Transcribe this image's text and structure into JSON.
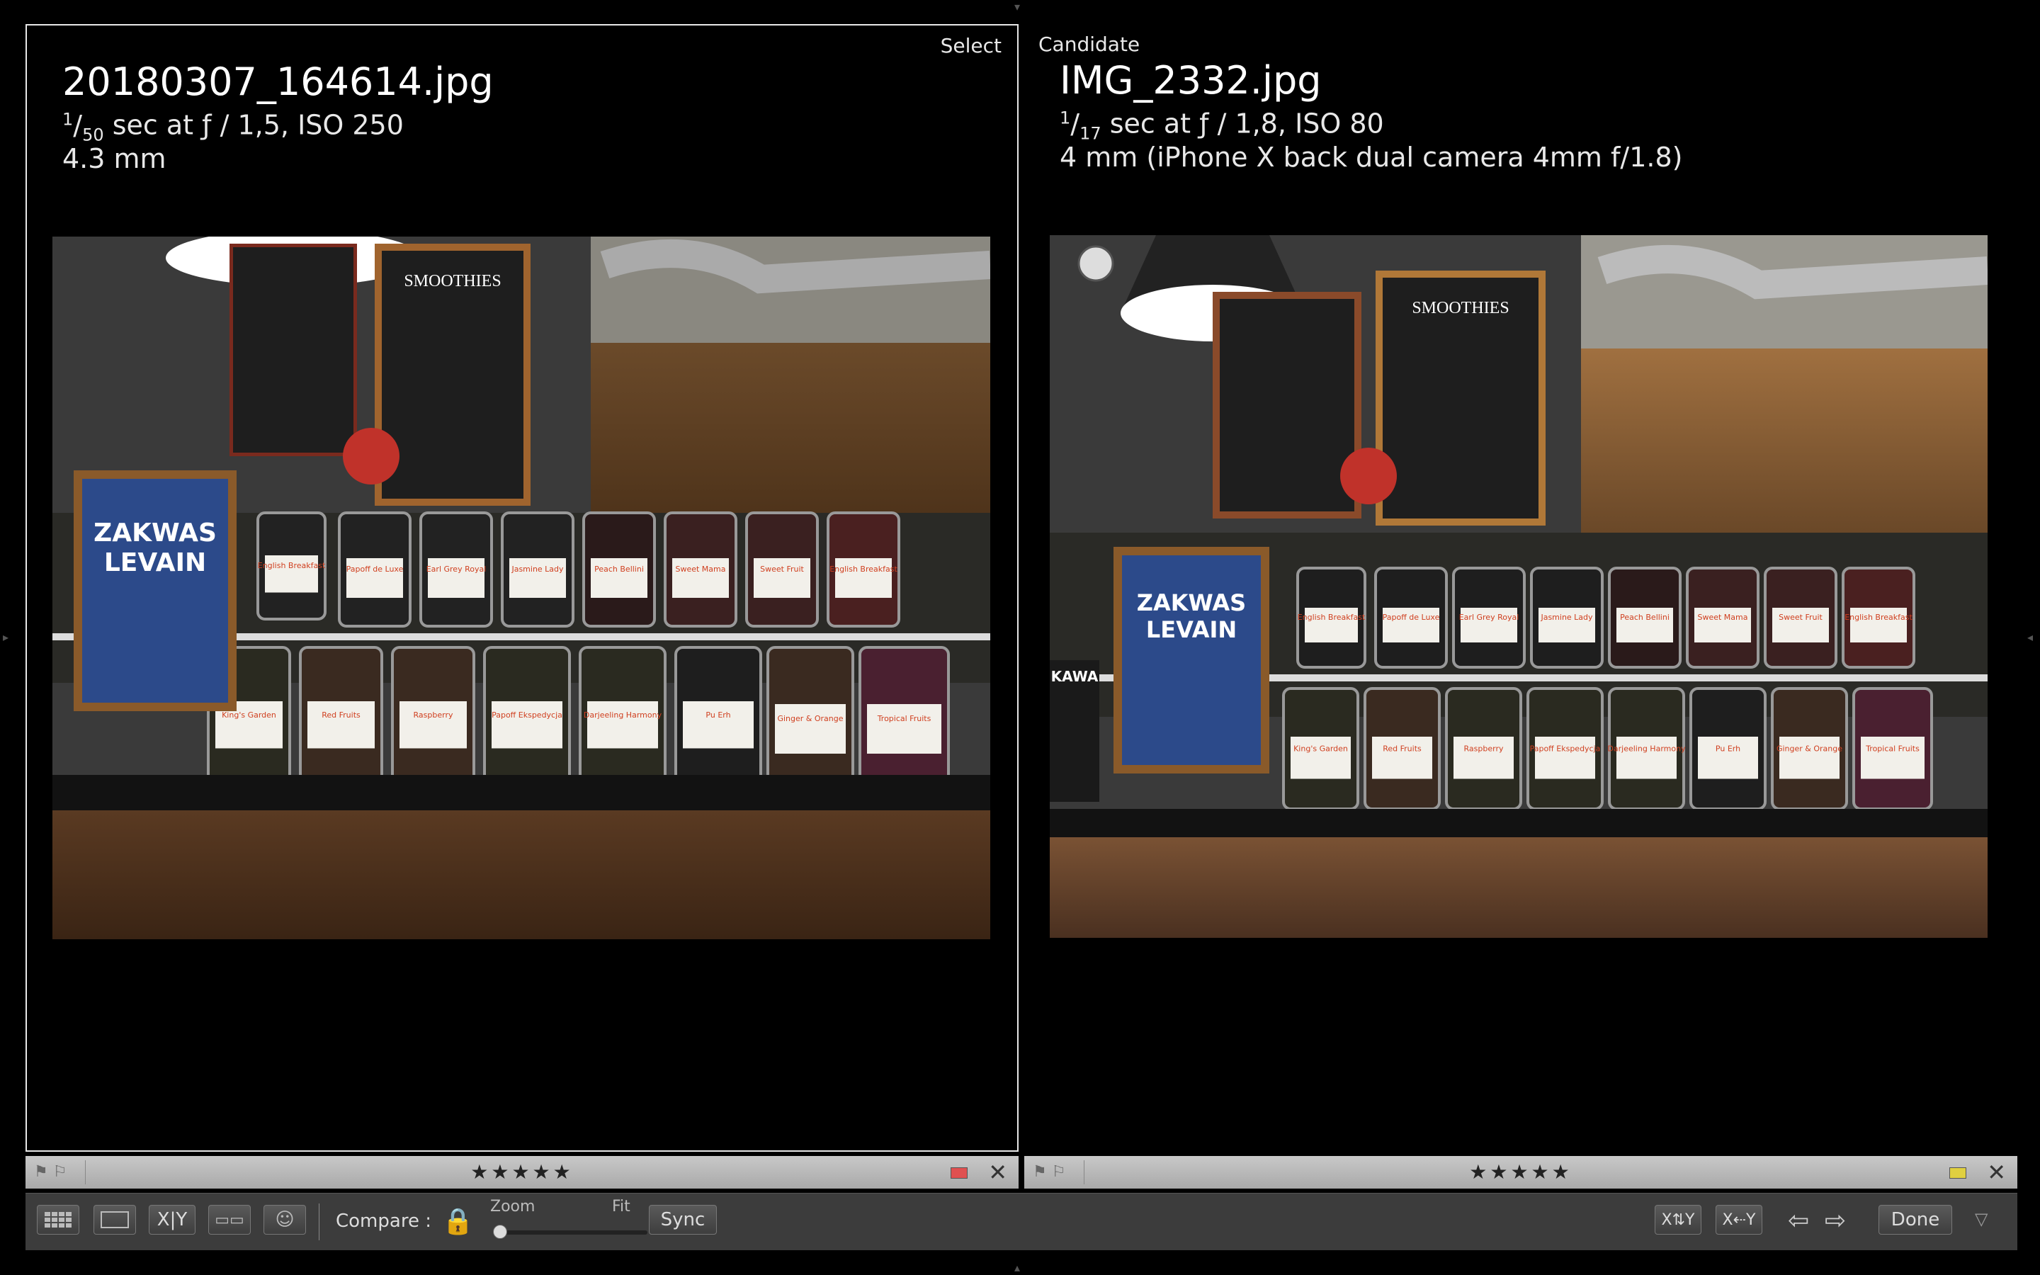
{
  "left": {
    "role": "Select",
    "filename": "20180307_164614.jpg",
    "exposure_num": "1",
    "exposure_den": "50",
    "exposure_rest": " sec at ƒ / 1,5, ISO 250",
    "focal": "4.3 mm",
    "stars": "★★★★★",
    "color_label": "#e05050"
  },
  "right": {
    "role": "Candidate",
    "filename": "IMG_2332.jpg",
    "exposure_num": "1",
    "exposure_den": "17",
    "exposure_rest": " sec at ƒ / 1,8, ISO 80",
    "focal": "4 mm (iPhone X back dual camera 4mm f/1.8)",
    "stars": "★★★★★",
    "color_label": "#e0d040"
  },
  "photo": {
    "menu_title": "SMOOTHIES",
    "sign_title": "ZAKWAS",
    "sign_subtitle": "LEVAIN",
    "jar_labels_top": [
      "English Breakfast",
      "Papoff de Luxe",
      "Earl Grey Royal",
      "Jasmine Lady",
      "Peach Bellini",
      "Sweet Mama",
      "Sweet Fruit"
    ],
    "jar_labels_bottom": [
      "King's Garden",
      "Red Fruits",
      "Raspberry",
      "Papoff Ekspedycja",
      "Darjeeling Harmony",
      "Pu Erh",
      "Ginger & Orange",
      "Tropical Fruits"
    ],
    "kawa": "KAWA"
  },
  "toolbar": {
    "compare_label": "Compare :",
    "zoom_label": "Zoom",
    "fit_label": "Fit",
    "sync_label": "Sync",
    "done_label": "Done",
    "xy_label": "X|Y"
  }
}
